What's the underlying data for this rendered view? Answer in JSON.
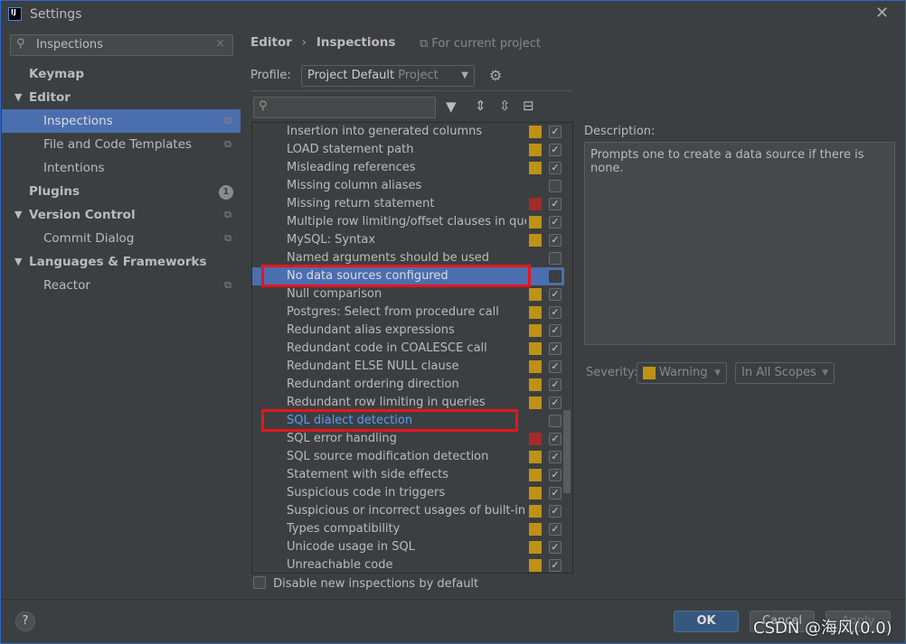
{
  "window": {
    "title": "Settings",
    "close_icon": "close-icon"
  },
  "sidebar": {
    "search_value": "Inspections",
    "items": [
      {
        "label": "Keymap",
        "level": 0,
        "bold": true
      },
      {
        "label": "Editor",
        "level": 0,
        "bold": true,
        "expanded": true
      },
      {
        "label": "Inspections",
        "level": 1,
        "selected": true,
        "project_icon": true
      },
      {
        "label": "File and Code Templates",
        "level": 1,
        "project_icon": true
      },
      {
        "label": "Intentions",
        "level": 1
      },
      {
        "label": "Plugins",
        "level": 0,
        "bold": true,
        "badge": "1"
      },
      {
        "label": "Version Control",
        "level": 0,
        "bold": true,
        "expanded": true,
        "project_icon": true
      },
      {
        "label": "Commit Dialog",
        "level": 1,
        "project_icon": true
      },
      {
        "label": "Languages & Frameworks",
        "level": 0,
        "bold": true,
        "expanded": true
      },
      {
        "label": "Reactor",
        "level": 1,
        "project_icon": true
      }
    ]
  },
  "header": {
    "breadcrumb": [
      "Editor",
      "Inspections"
    ],
    "scope_note": "For current project"
  },
  "profile": {
    "label": "Profile:",
    "value": "Project Default",
    "sub": "Project"
  },
  "colors": {
    "warning": "#be9117",
    "error": "#a52a2a",
    "selection": "#4b6eaf",
    "accent": "#365880"
  },
  "inspections": [
    {
      "label": "Insertion into generated columns",
      "severity": "warning",
      "checked": true
    },
    {
      "label": "LOAD statement path",
      "severity": "warning",
      "checked": true
    },
    {
      "label": "Misleading references",
      "severity": "warning",
      "checked": true
    },
    {
      "label": "Missing column aliases",
      "severity": "none",
      "checked": false
    },
    {
      "label": "Missing return statement",
      "severity": "error",
      "checked": true
    },
    {
      "label": "Multiple row limiting/offset clauses in quer",
      "severity": "warning",
      "checked": true
    },
    {
      "label": "MySQL: Syntax",
      "severity": "warning",
      "checked": true
    },
    {
      "label": "Named arguments should be used",
      "severity": "none",
      "checked": false
    },
    {
      "label": "No data sources configured",
      "severity": "none",
      "checked": false,
      "selected": true,
      "highlighted": true
    },
    {
      "label": "Null comparison",
      "severity": "warning",
      "checked": true
    },
    {
      "label": "Postgres: Select from procedure call",
      "severity": "warning",
      "checked": true
    },
    {
      "label": "Redundant alias expressions",
      "severity": "warning",
      "checked": true
    },
    {
      "label": "Redundant code in COALESCE call",
      "severity": "warning",
      "checked": true
    },
    {
      "label": "Redundant ELSE NULL clause",
      "severity": "warning",
      "checked": true
    },
    {
      "label": "Redundant ordering direction",
      "severity": "warning",
      "checked": true
    },
    {
      "label": "Redundant row limiting in queries",
      "severity": "warning",
      "checked": true
    },
    {
      "label": "SQL dialect detection",
      "severity": "none",
      "checked": false,
      "link": true,
      "highlighted": true
    },
    {
      "label": "SQL error handling",
      "severity": "error",
      "checked": true
    },
    {
      "label": "SQL source modification detection",
      "severity": "warning",
      "checked": true
    },
    {
      "label": "Statement with side effects",
      "severity": "warning",
      "checked": true
    },
    {
      "label": "Suspicious code in triggers",
      "severity": "warning",
      "checked": true
    },
    {
      "label": "Suspicious or incorrect usages of built-in fu",
      "severity": "warning",
      "checked": true
    },
    {
      "label": "Types compatibility",
      "severity": "warning",
      "checked": true
    },
    {
      "label": "Unicode usage in SQL",
      "severity": "warning",
      "checked": true
    },
    {
      "label": "Unreachable code",
      "severity": "warning",
      "checked": true
    }
  ],
  "description": {
    "label": "Description:",
    "text": "Prompts one to create a data source if there is none."
  },
  "severity": {
    "label": "Severity:",
    "value": "Warning",
    "scope": "In All Scopes"
  },
  "disable_new": {
    "label": "Disable new inspections by default",
    "checked": false
  },
  "buttons": {
    "ok": "OK",
    "cancel": "Cancel",
    "apply": "Apply",
    "help": "?"
  },
  "watermark": "CSDN @海风(0.0)"
}
